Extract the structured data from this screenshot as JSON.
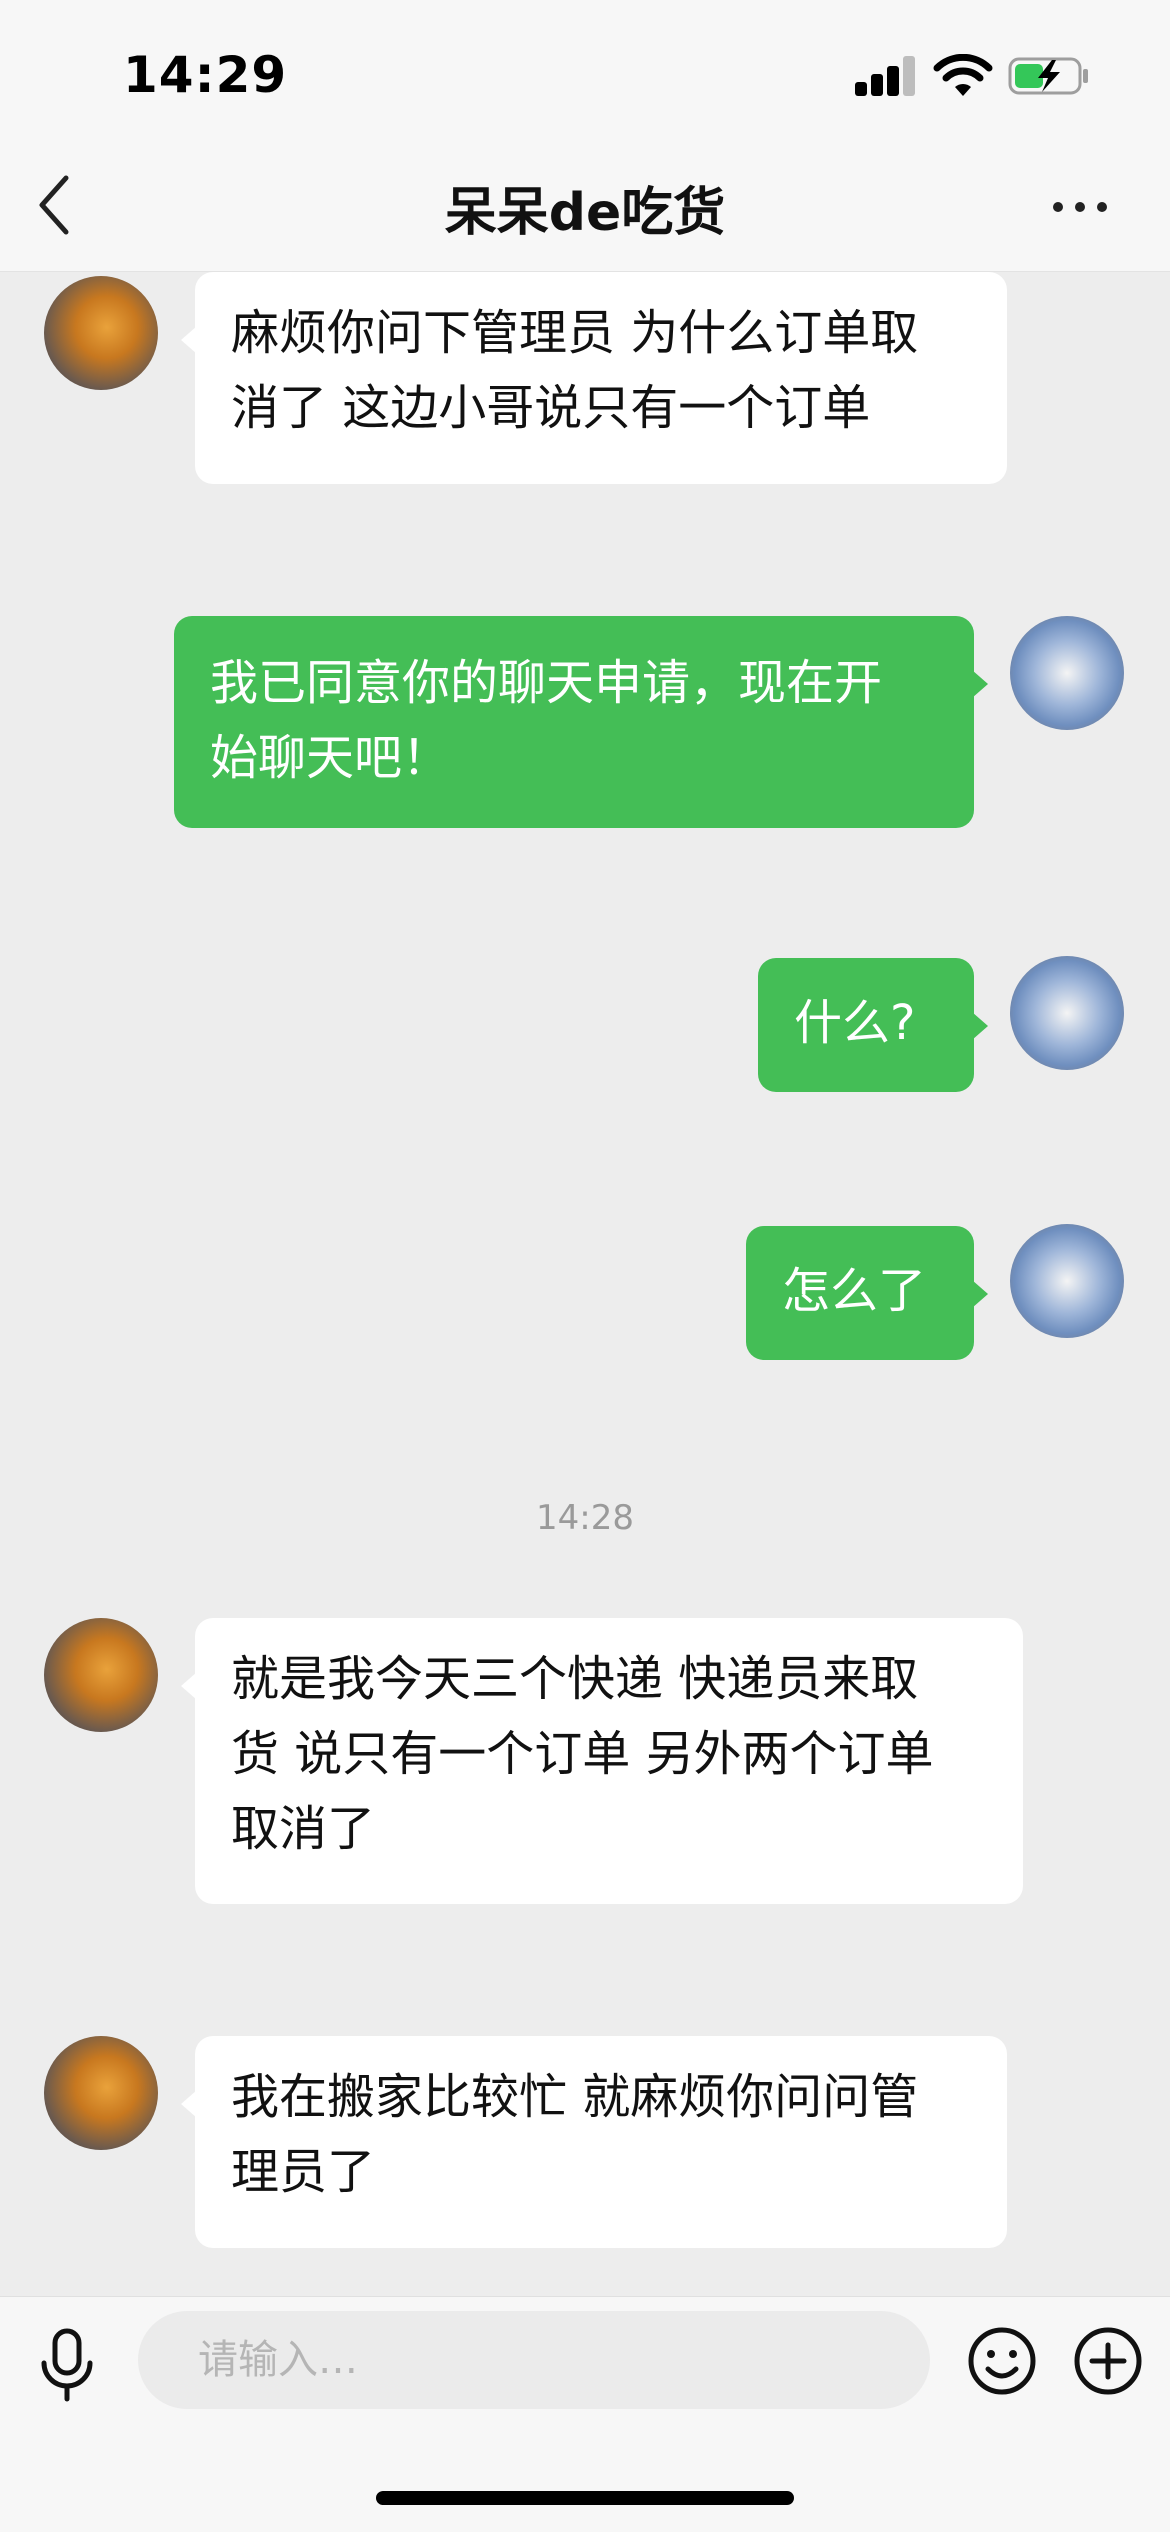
{
  "status_bar": {
    "time": "14:29"
  },
  "header": {
    "title": "呆呆de吃货",
    "back_icon": "chevron-left-icon",
    "more_icon": "more-dots-icon"
  },
  "colors": {
    "accent_green": "#44BE56",
    "background": "#EDEDED",
    "incoming_bubble": "#FFFFFF"
  },
  "messages": [
    {
      "sender": "other",
      "lines": [
        "麻烦你问下管理员 为什么订单取",
        "消了 这边小哥说只有一个订单"
      ]
    },
    {
      "sender": "me",
      "lines": [
        "我已同意你的聊天申请，现在开",
        "始聊天吧！"
      ]
    },
    {
      "sender": "me",
      "lines": [
        "什么?"
      ]
    },
    {
      "sender": "me",
      "lines": [
        "怎么了"
      ]
    },
    {
      "sender": "other",
      "lines": [
        "就是我今天三个快递 快递员来取",
        "货 说只有一个订单 另外两个订单",
        "取消了"
      ]
    },
    {
      "sender": "other",
      "lines": [
        "我在搬家比较忙 就麻烦你问问管",
        "理员了"
      ]
    }
  ],
  "timestamp": "14:28",
  "input": {
    "placeholder": "请输入…",
    "value": ""
  },
  "icons": {
    "voice": "microphone-icon",
    "emoji": "emoji-icon",
    "add": "plus-circle-icon"
  }
}
